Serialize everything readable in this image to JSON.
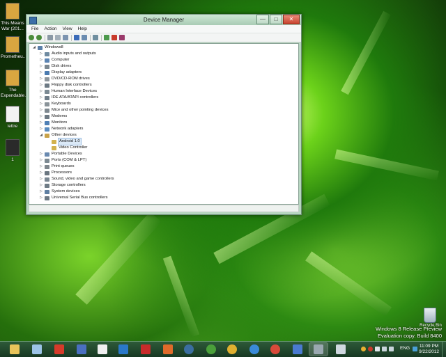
{
  "window": {
    "title": "Device Manager",
    "controls": {
      "minimize": "—",
      "maximize": "□",
      "close": "✕"
    },
    "menu": [
      "File",
      "Action",
      "View",
      "Help"
    ]
  },
  "tree": [
    {
      "label": "Windows8",
      "depth": 0,
      "expander": "◢",
      "color": "#5a7fa8"
    },
    {
      "label": "Audio inputs and outputs",
      "depth": 1,
      "expander": "▷",
      "color": "#6f8aa0"
    },
    {
      "label": "Computer",
      "depth": 1,
      "expander": "▷",
      "color": "#5b84b3"
    },
    {
      "label": "Disk drives",
      "depth": 1,
      "expander": "▷",
      "color": "#7b8790"
    },
    {
      "label": "Display adapters",
      "depth": 1,
      "expander": "▷",
      "color": "#4b7bb0"
    },
    {
      "label": "DVD/CD-ROM drives",
      "depth": 1,
      "expander": "▷",
      "color": "#8e969c"
    },
    {
      "label": "Floppy disk controllers",
      "depth": 1,
      "expander": "▷",
      "color": "#6d7a84"
    },
    {
      "label": "Human Interface Devices",
      "depth": 1,
      "expander": "▷",
      "color": "#7c8a93"
    },
    {
      "label": "IDE ATA/ATAPI controllers",
      "depth": 1,
      "expander": "▷",
      "color": "#6f7d88"
    },
    {
      "label": "Keyboards",
      "depth": 1,
      "expander": "▷",
      "color": "#8a9399"
    },
    {
      "label": "Mice and other pointing devices",
      "depth": 1,
      "expander": "▷",
      "color": "#7f8990"
    },
    {
      "label": "Modems",
      "depth": 1,
      "expander": "▷",
      "color": "#6e7a84"
    },
    {
      "label": "Monitors",
      "depth": 1,
      "expander": "▷",
      "color": "#4f80b6"
    },
    {
      "label": "Network adapters",
      "depth": 1,
      "expander": "▷",
      "color": "#5a8cc0"
    },
    {
      "label": "Other devices",
      "depth": 1,
      "expander": "◢",
      "color": "#c8a24a"
    },
    {
      "label": "Android 1.0",
      "depth": 2,
      "expander": "",
      "color": "#d2b24e",
      "selected": true
    },
    {
      "label": "Video Controller",
      "depth": 2,
      "expander": "",
      "color": "#d2b24e"
    },
    {
      "label": "Portable Devices",
      "depth": 1,
      "expander": "▷",
      "color": "#6a8ab0"
    },
    {
      "label": "Ports (COM & LPT)",
      "depth": 1,
      "expander": "▷",
      "color": "#7d8a92"
    },
    {
      "label": "Print queues",
      "depth": 1,
      "expander": "▷",
      "color": "#7f878d"
    },
    {
      "label": "Processors",
      "depth": 1,
      "expander": "▷",
      "color": "#6a7680"
    },
    {
      "label": "Sound, video and game controllers",
      "depth": 1,
      "expander": "▷",
      "color": "#7a8792"
    },
    {
      "label": "Storage controllers",
      "depth": 1,
      "expander": "▷",
      "color": "#6f7c86"
    },
    {
      "label": "System devices",
      "depth": 1,
      "expander": "▷",
      "color": "#5f7fa2"
    },
    {
      "label": "Universal Serial Bus controllers",
      "depth": 1,
      "expander": "▷",
      "color": "#6c7883"
    }
  ],
  "desktop_icons": [
    {
      "label": "This Means War (201...",
      "color": "#d9a640"
    },
    {
      "label": "Prometheu...",
      "color": "#d9a640"
    },
    {
      "label": "The Expendable...",
      "color": "#d9a640"
    },
    {
      "label": "lettre",
      "color": "#f2f2f2"
    },
    {
      "label": "1",
      "color": "#2a2a2a"
    }
  ],
  "watermark": {
    "line1": "Windows 8 Release Preview",
    "line2": "Evaluation copy. Build 8400"
  },
  "recycle_bin": {
    "label": "Recycle Bin"
  },
  "taskbar": {
    "apps": [
      {
        "name": "file-explorer",
        "color": "#e8c45a"
      },
      {
        "name": "app-2",
        "color": "#9cc3e6"
      },
      {
        "name": "acrobat",
        "color": "#d63a2a"
      },
      {
        "name": "app-4",
        "color": "#4a6fc0"
      },
      {
        "name": "counter-strike",
        "color": "#f0f0f0"
      },
      {
        "name": "teamviewer",
        "color": "#2a78c8"
      },
      {
        "name": "app-7",
        "color": "#c82a2a"
      },
      {
        "name": "app-8",
        "color": "#e06a2a"
      },
      {
        "name": "steam",
        "color": "#3b6ea0"
      },
      {
        "name": "utorrent",
        "color": "#4aa03a"
      },
      {
        "name": "chrome",
        "color": "#e0b030"
      },
      {
        "name": "internet-explorer",
        "color": "#3a8ad8"
      },
      {
        "name": "chrome-2",
        "color": "#d84a3a"
      },
      {
        "name": "app-14",
        "color": "#4a7ad0"
      },
      {
        "name": "device-manager",
        "color": "#9aa8b0"
      },
      {
        "name": "paint",
        "color": "#d0d8e0"
      }
    ],
    "language": "ENG",
    "time": "11:09 PM",
    "date": "9/22/2012"
  }
}
